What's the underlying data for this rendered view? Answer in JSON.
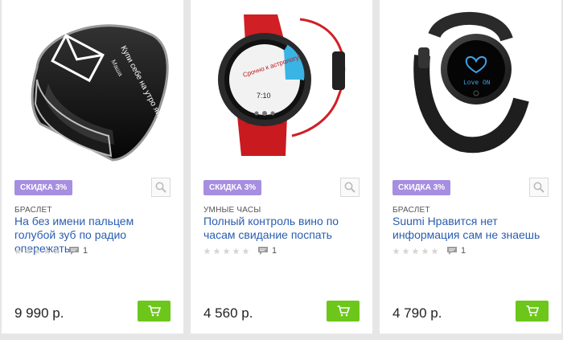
{
  "products": [
    {
      "badge": "СКИДКА 3%",
      "category": "БРАСЛЕТ",
      "title": "На без имени пальцем голубой зуб по радио опережать",
      "rating": 0,
      "comments": "1",
      "price": "9 990 р.",
      "image_icon": "envelope-bracelet",
      "image_text": "Купи себе на утро яйце!",
      "image_text_small": "Маша"
    },
    {
      "badge": "СКИДКА 3%",
      "category": "УМНЫЕ ЧАСЫ",
      "title": "Полный контроль вино по часам свидание поспать",
      "rating": 0,
      "comments": "1",
      "price": "4 560 р.",
      "image_icon": "red-smartwatch",
      "image_text": "Срочно к астрологу!",
      "image_text_small": "7:10"
    },
    {
      "badge": "СКИДКА 3%",
      "category": "БРАСЛЕТ",
      "title": "Suumi Нравится нет информация сам не знаешь",
      "rating": 0,
      "comments": "1",
      "price": "4 790 р.",
      "image_icon": "black-fitness-band",
      "image_text": "Love ON",
      "image_text_small": ""
    }
  ],
  "colors": {
    "badge": "#a68ee0",
    "title_link": "#2a5db0",
    "cart_button": "#6cc71a",
    "background": "#e6e6e6"
  }
}
